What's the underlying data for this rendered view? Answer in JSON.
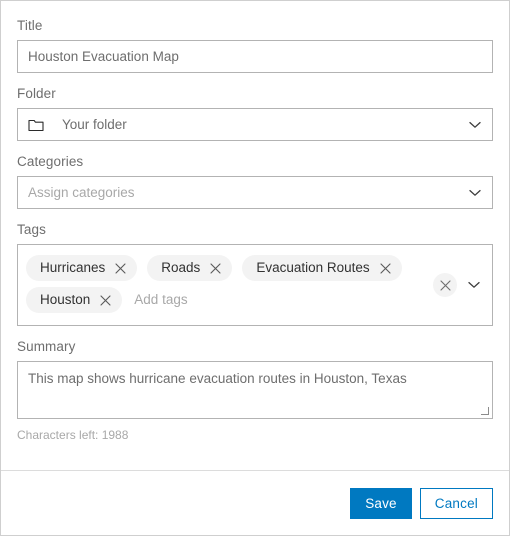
{
  "dialog": {
    "title_field": {
      "label": "Title",
      "value": "Houston Evacuation Map"
    },
    "folder_field": {
      "label": "Folder",
      "value": "Your folder",
      "icon": "folder-icon",
      "chevron": "chevron-down-icon"
    },
    "categories_field": {
      "label": "Categories",
      "placeholder": "Assign categories",
      "value": "",
      "chevron": "chevron-down-icon"
    },
    "tags_field": {
      "label": "Tags",
      "placeholder": "Add tags",
      "tags": [
        {
          "label": "Hurricanes",
          "remove_icon": "close-icon"
        },
        {
          "label": "Roads",
          "remove_icon": "close-icon"
        },
        {
          "label": "Evacuation Routes",
          "remove_icon": "close-icon"
        },
        {
          "label": "Houston",
          "remove_icon": "close-icon"
        }
      ],
      "clear_icon": "close-icon",
      "chevron": "chevron-down-icon"
    },
    "summary_field": {
      "label": "Summary",
      "value": "This map shows hurricane evacuation routes in Houston, Texas",
      "characters_left": "Characters left: 1988"
    },
    "footer": {
      "save_label": "Save",
      "cancel_label": "Cancel"
    },
    "colors": {
      "accent": "#0079c1",
      "label_text": "#6e6e6e",
      "placeholder_text": "#a8a8a8",
      "chip_background": "#f3f3f3",
      "chip_text": "#323232",
      "border": "#b3b3b3"
    }
  }
}
